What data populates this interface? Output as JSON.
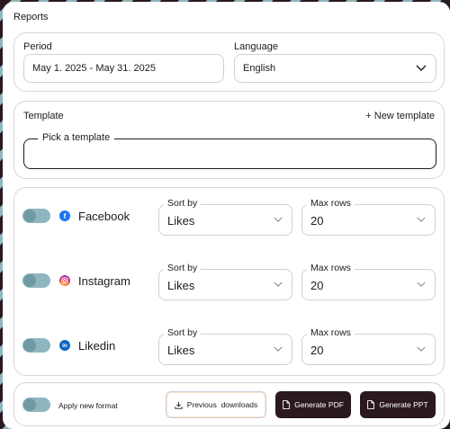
{
  "header": {
    "title": "Reports"
  },
  "period": {
    "label": "Period",
    "value": "May 1. 2025 - May 31. 2025"
  },
  "language": {
    "label": "Language",
    "value": "English"
  },
  "template": {
    "label": "Template",
    "new_link": "+ New template",
    "legend": "Pick a template",
    "value": ""
  },
  "networks": [
    {
      "name": "Facebook",
      "icon": "facebook-icon",
      "enabled": true,
      "sort_label": "Sort by",
      "sort_value": "Likes",
      "rows_label": "Max rows",
      "rows_value": "20"
    },
    {
      "name": "Instagram",
      "icon": "instagram-icon",
      "enabled": true,
      "sort_label": "Sort by",
      "sort_value": "Likes",
      "rows_label": "Max rows",
      "rows_value": "20"
    },
    {
      "name": "Likedin",
      "icon": "linkedin-icon",
      "enabled": true,
      "sort_label": "Sort by",
      "sort_value": "Likes",
      "rows_label": "Max rows",
      "rows_value": "20"
    }
  ],
  "footer": {
    "format_label": "Apply new format",
    "format_enabled": true,
    "previous_downloads": "Previous  downloads",
    "generate_pdf": "Generate PDF",
    "generate_ppt": "Generate PPT"
  },
  "colors": {
    "dark": "#2a1a1f",
    "toggle": "#8fb6bf",
    "facebook": "#1877f2",
    "linkedin": "#0a66c2"
  }
}
